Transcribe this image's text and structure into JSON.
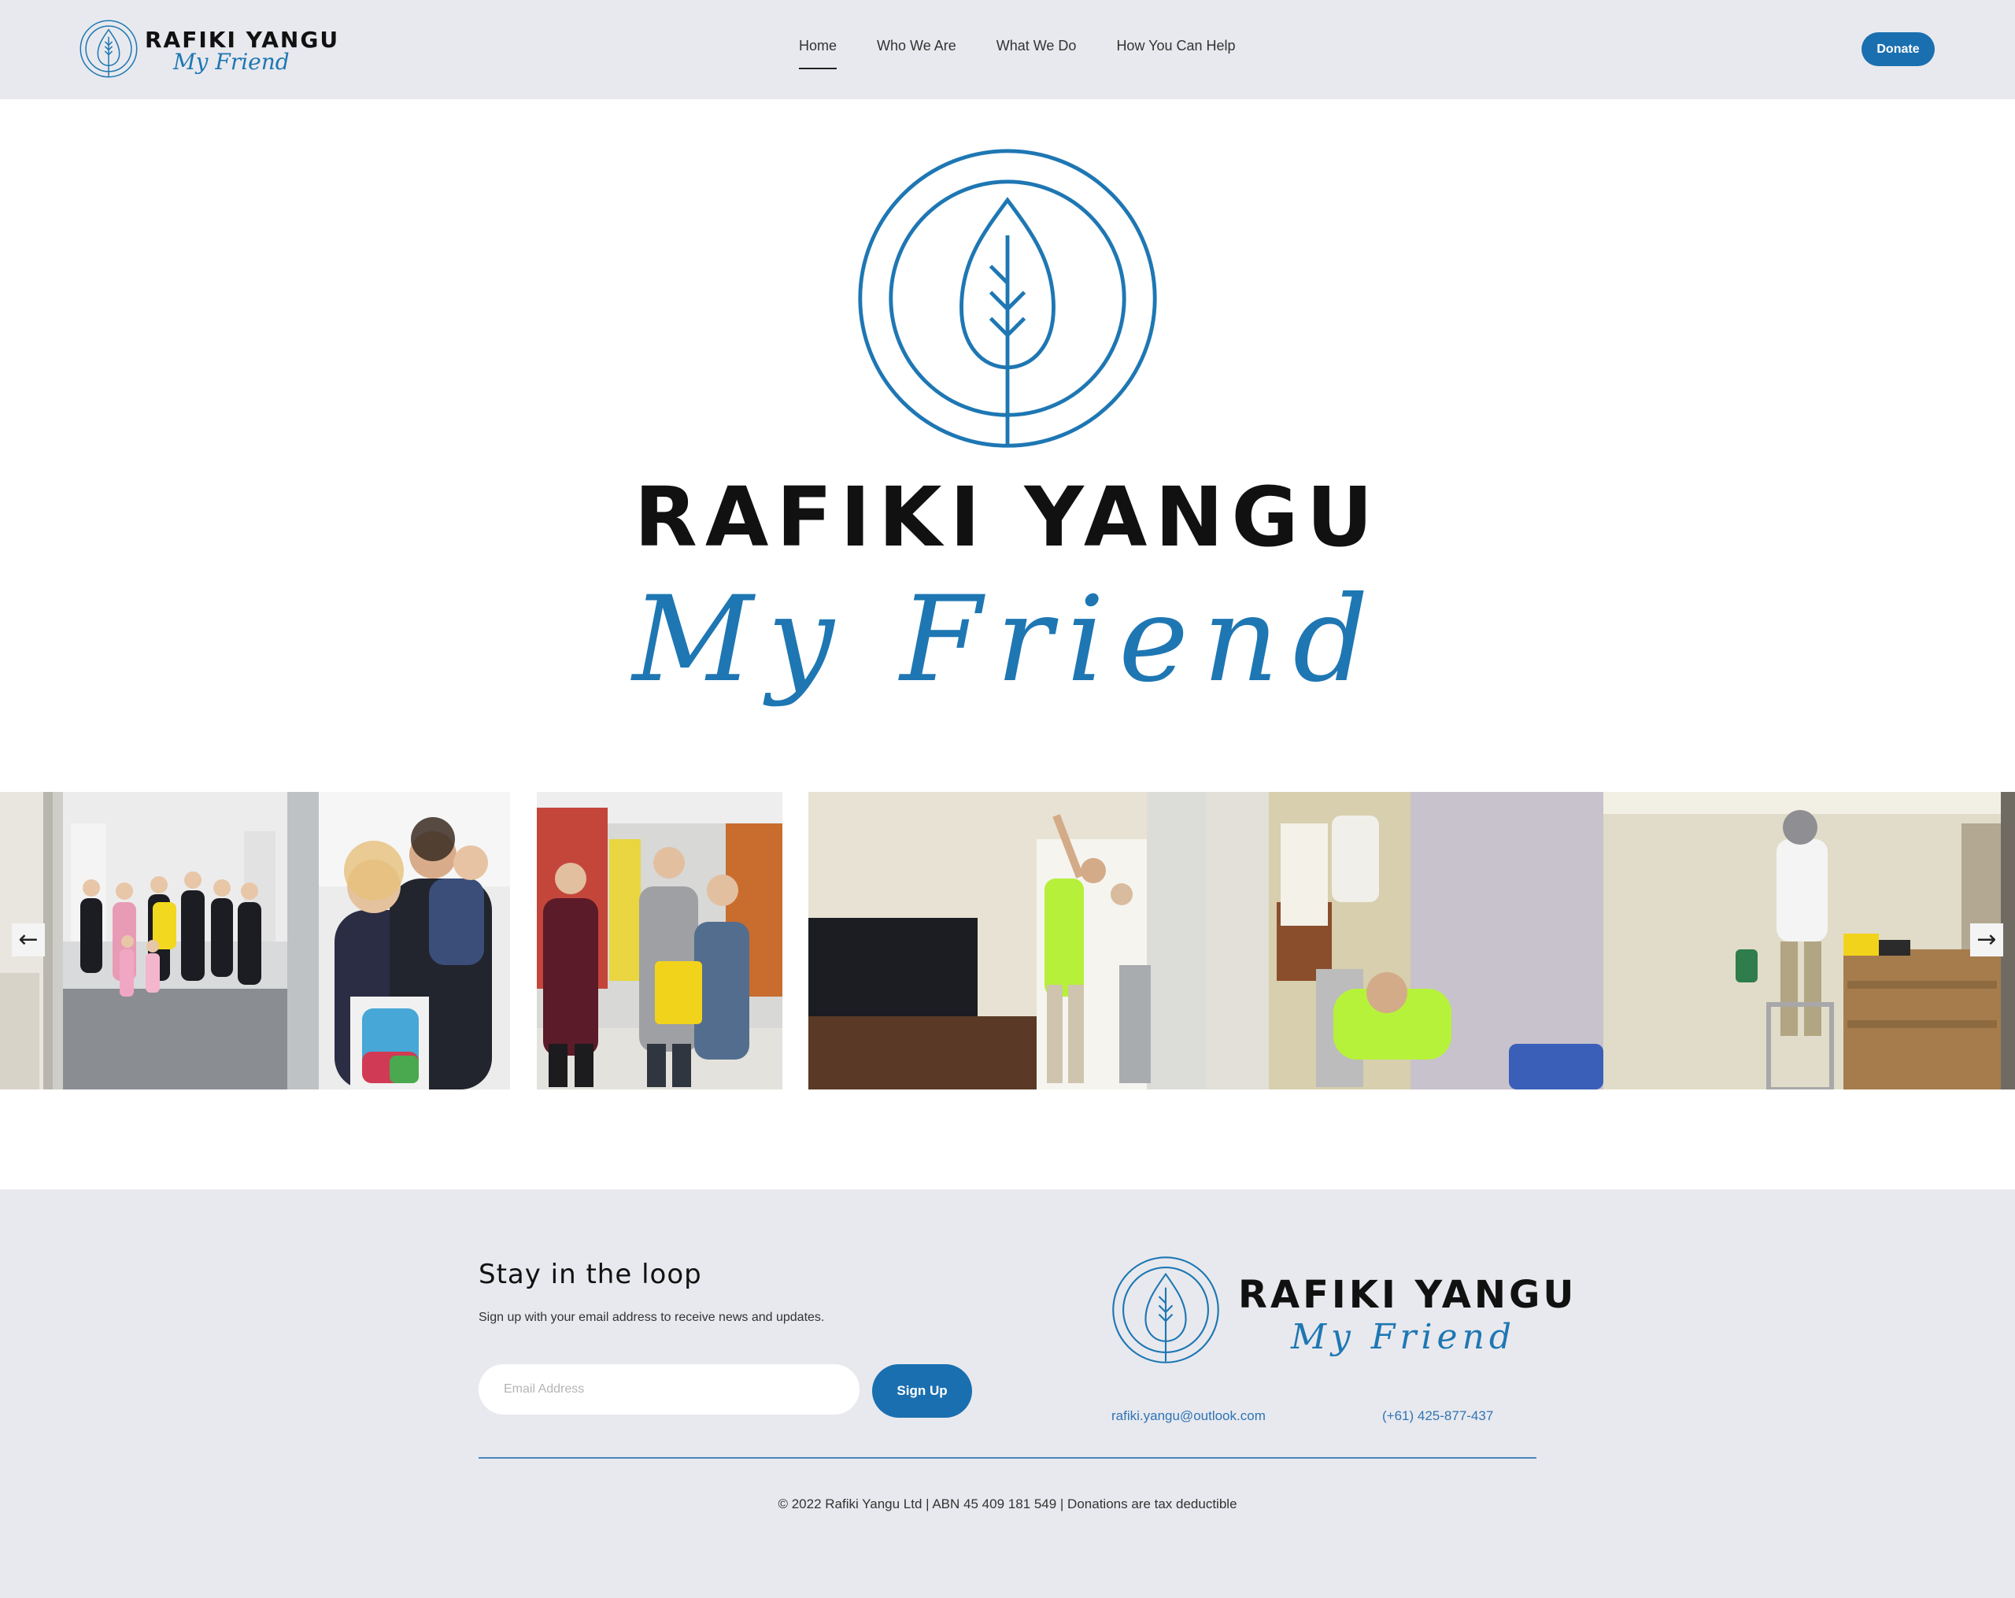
{
  "header": {
    "logo": {
      "brand": "RAFIKI YANGU",
      "script": "My Friend"
    },
    "nav": [
      {
        "label": "Home",
        "active": true
      },
      {
        "label": "Who We Are",
        "active": false
      },
      {
        "label": "What We Do",
        "active": false
      },
      {
        "label": "How You Can Help",
        "active": false
      }
    ],
    "donate_label": "Donate"
  },
  "hero": {
    "brand": "RAFIKI YANGU",
    "script": "My Friend"
  },
  "gallery": {
    "prev_icon": "←",
    "next_icon": "→",
    "photos": [
      "partial-photo-left-edge",
      "group-photo-family",
      "family-birthday-cake",
      "store-group-photo",
      "tv-room-painting",
      "bathroom-renovation",
      "wall-painting-ladder",
      "partial-photo-right-edge"
    ]
  },
  "footer": {
    "title": "Stay in the loop",
    "subtitle": "Sign up with your email address to receive news and updates.",
    "email_placeholder": "Email Address",
    "signup_label": "Sign Up",
    "logo": {
      "brand": "RAFIKI YANGU",
      "script": "My Friend"
    },
    "email": "rafiki.yangu@outlook.com",
    "phone": "(+61) 425-877-437",
    "copyright": "© 2022 Rafiki Yangu Ltd | ABN 45 409 181 549 | Donations are tax deductible"
  },
  "colors": {
    "brand_blue": "#1a6fb0",
    "header_bg": "#e8e9ee",
    "link_blue": "#2f74b5"
  }
}
